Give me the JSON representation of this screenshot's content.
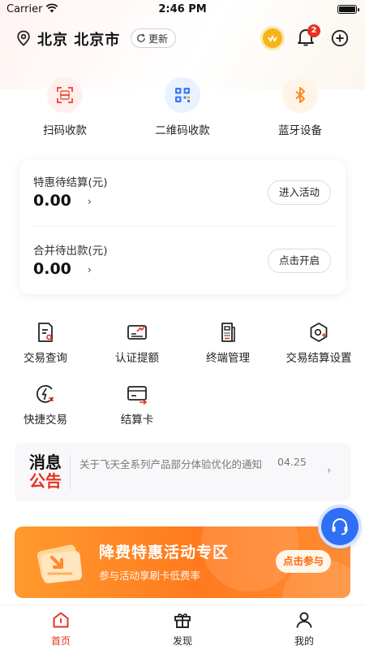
{
  "status_bar": {
    "carrier": "Carrier",
    "time": "2:46 PM"
  },
  "header": {
    "location": "北京 北京市",
    "update_label": "更新",
    "notification_count": "2"
  },
  "quick_actions": [
    {
      "label": "扫码收款",
      "icon": "scan-icon"
    },
    {
      "label": "二维码收款",
      "icon": "qr-code-icon"
    },
    {
      "label": "蓝牙设备",
      "icon": "bluetooth-icon"
    }
  ],
  "settlement": {
    "discount": {
      "title": "特惠待结算(元)",
      "amount": "0.00",
      "button": "进入活动"
    },
    "merged": {
      "title": "合并待出款(元)",
      "amount": "0.00",
      "button": "点击开启"
    }
  },
  "services": [
    {
      "label": "交易查询",
      "icon": "transaction-search-icon"
    },
    {
      "label": "认证提额",
      "icon": "limit-raise-icon"
    },
    {
      "label": "终端管理",
      "icon": "terminal-icon"
    },
    {
      "label": "交易结算设置",
      "icon": "settlement-settings-icon"
    },
    {
      "label": "快捷交易",
      "icon": "quick-trade-icon"
    },
    {
      "label": "结算卡",
      "icon": "settlement-card-icon"
    }
  ],
  "notice": {
    "logo_line1": "消息",
    "logo_line2": "公告",
    "text": "关于飞天全系列产品部分体验优化的通知",
    "date": "04.25"
  },
  "promo": {
    "title": "降费特惠活动专区",
    "subtitle": "参与活动享刷卡低费率",
    "button": "点击参与"
  },
  "tab_bar": [
    {
      "label": "首页",
      "icon": "home-icon",
      "active": true
    },
    {
      "label": "发现",
      "icon": "gift-icon",
      "active": false
    },
    {
      "label": "我的",
      "icon": "profile-icon",
      "active": false
    }
  ],
  "colors": {
    "brand_red": "#e63223",
    "promo_orange": "#ff7a1e",
    "support_blue": "#2f6ff5"
  }
}
